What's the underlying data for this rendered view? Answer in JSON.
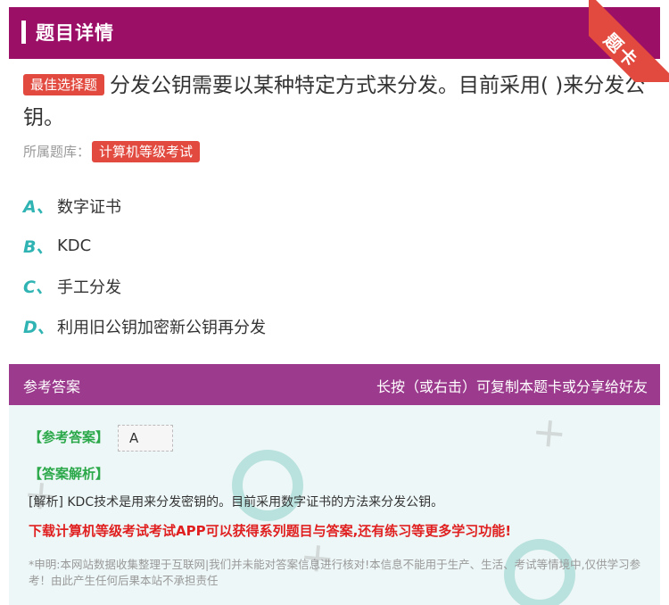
{
  "header": {
    "title": "题目详情",
    "ribbon": "题卡"
  },
  "question": {
    "badge": "最佳选择题",
    "text": "分发公钥需要以某种特定方式来分发。目前采用( )来分发公钥。",
    "bank_label": "所属题库：",
    "bank_tag": "计算机等级考试"
  },
  "options": [
    {
      "letter": "A、",
      "text": "数字证书"
    },
    {
      "letter": "B、",
      "text": "KDC"
    },
    {
      "letter": "C、",
      "text": "手工分发"
    },
    {
      "letter": "D、",
      "text": "利用旧公钥加密新公钥再分发"
    }
  ],
  "answer_section": {
    "title": "参考答案",
    "share_hint": "长按（或右击）可复制本题卡或分享给好友",
    "answer_label": "【参考答案】",
    "answer_value": "A",
    "analysis_label": "【答案解析】",
    "analysis_text": "[解析] KDC技术是用来分发密钥的。目前采用数字证书的方法来分发公钥。",
    "download_text": "下载计算机等级考试考试APP可以获得系列题目与答案,还有练习等更多学习功能!",
    "notice": "*申明:本网站数据收集整理于互联网|我们并未能对答案信息进行核对!本信息不能用于生产、生活、考试等情境中,仅供学习参考！由此产生任何后果本站不承担责任"
  },
  "colors": {
    "header": "#9c0f66",
    "accent": "#e2493f",
    "answer_header": "#9c3b8e",
    "option_letter": "#2fb3b3",
    "green": "#2ba84a"
  }
}
